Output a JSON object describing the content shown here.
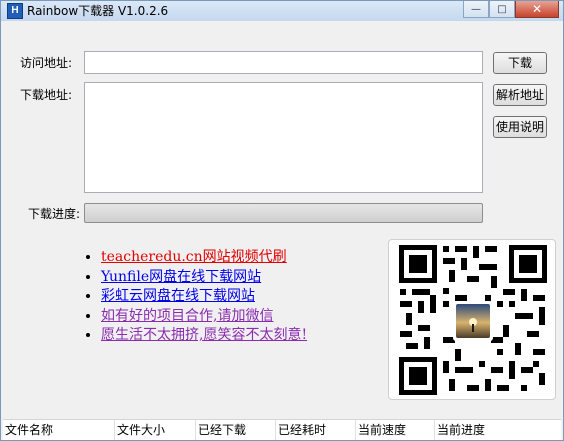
{
  "window": {
    "title": "Rainbow下载器 V1.0.2.6",
    "app_icon_letter": "H",
    "minimize_glyph": "—",
    "maximize_glyph": "□",
    "close_glyph": "✕"
  },
  "form": {
    "visit_label": "访问地址:",
    "visit_value": "",
    "download_label": "下载地址:",
    "download_value": "",
    "download_button": "下载",
    "parse_button": "解析地址",
    "help_button": "使用说明",
    "progress_label": "下载进度:",
    "progress_value": 0
  },
  "links": [
    {
      "text": "teacheredu.cn网站视频代刷",
      "color": "#e00000"
    },
    {
      "text": "Yunfile网盘在线下载网站",
      "color": "#0000ee"
    },
    {
      "text": "彩虹云网盘在线下载网站",
      "color": "#0000ee"
    },
    {
      "text": "如有好的项目合作,请加微信",
      "color": "#8a2bb0"
    },
    {
      "text": "愿生活不太拥挤,愿笑容不太刻意!",
      "color": "#8a2bb0"
    }
  ],
  "qr": {
    "icon": "qr-code-icon",
    "center_image": "avatar-sunset-icon"
  },
  "list_columns": [
    "文件名称",
    "文件大小",
    "已经下载",
    "已经耗时",
    "当前速度",
    "当前进度"
  ]
}
